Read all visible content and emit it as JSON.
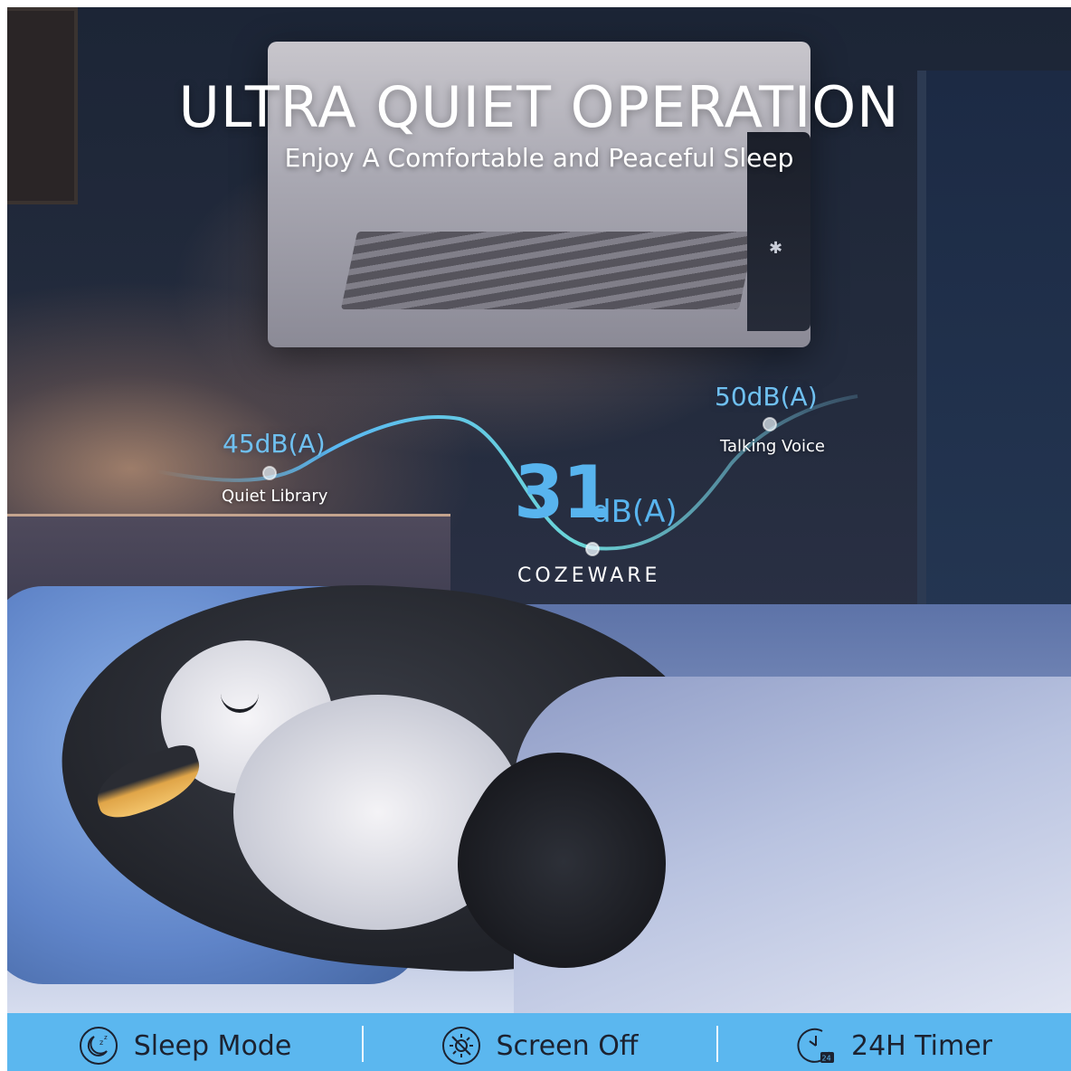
{
  "headline": {
    "title": "ULTRA QUIET OPERATION",
    "subtitle": "Enjoy A Comfortable and Peaceful Sleep"
  },
  "noise_levels": [
    {
      "value": "45dB(A)",
      "caption": "Quiet Library"
    },
    {
      "value_number": "31",
      "value_unit": "dB(A)",
      "caption": "COZEWARE"
    },
    {
      "value": "50dB(A)",
      "caption": "Talking Voice"
    }
  ],
  "features": [
    {
      "label": "Sleep Mode",
      "icon": "sleep-mode-icon"
    },
    {
      "label": "Screen Off",
      "icon": "screen-off-icon"
    },
    {
      "label": "24H Timer",
      "icon": "timer-24h-icon"
    }
  ],
  "colors": {
    "accent": "#5bb7ef",
    "wave": "#7fd0f0",
    "label_blue": "#6fc0f0",
    "feature_text": "#1c2230"
  }
}
